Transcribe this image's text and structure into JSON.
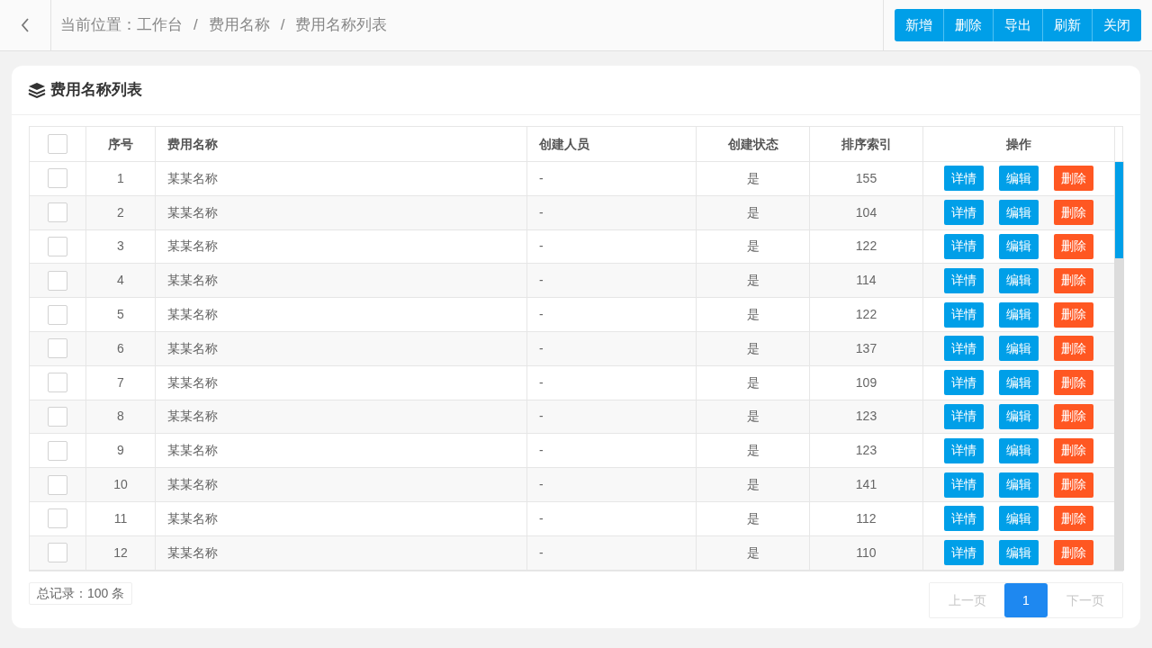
{
  "breadcrumb": {
    "label": "当前位置：",
    "items": [
      "工作台",
      "费用名称",
      "费用名称列表"
    ],
    "separator": "/"
  },
  "toolbar": [
    "新增",
    "删除",
    "导出",
    "刷新",
    "关闭"
  ],
  "panel": {
    "title": "费用名称列表"
  },
  "table": {
    "select_all_checked": false,
    "columns": [
      "序号",
      "费用名称",
      "创建人员",
      "创建状态",
      "排序索引",
      "操作"
    ],
    "rows": [
      {
        "checked": false,
        "cells": [
          "1",
          "某某名称",
          "-",
          "是",
          "155"
        ],
        "actions": [
          "详情",
          "编辑",
          "删除"
        ]
      },
      {
        "checked": false,
        "cells": [
          "2",
          "某某名称",
          "-",
          "是",
          "104"
        ],
        "actions": [
          "详情",
          "编辑",
          "删除"
        ]
      },
      {
        "checked": false,
        "cells": [
          "3",
          "某某名称",
          "-",
          "是",
          "122"
        ],
        "actions": [
          "详情",
          "编辑",
          "删除"
        ]
      },
      {
        "checked": false,
        "cells": [
          "4",
          "某某名称",
          "-",
          "是",
          "114"
        ],
        "actions": [
          "详情",
          "编辑",
          "删除"
        ]
      },
      {
        "checked": false,
        "cells": [
          "5",
          "某某名称",
          "-",
          "是",
          "122"
        ],
        "actions": [
          "详情",
          "编辑",
          "删除"
        ]
      },
      {
        "checked": false,
        "cells": [
          "6",
          "某某名称",
          "-",
          "是",
          "137"
        ],
        "actions": [
          "详情",
          "编辑",
          "删除"
        ]
      },
      {
        "checked": false,
        "cells": [
          "7",
          "某某名称",
          "-",
          "是",
          "109"
        ],
        "actions": [
          "详情",
          "编辑",
          "删除"
        ]
      },
      {
        "checked": false,
        "cells": [
          "8",
          "某某名称",
          "-",
          "是",
          "123"
        ],
        "actions": [
          "详情",
          "编辑",
          "删除"
        ]
      },
      {
        "checked": false,
        "cells": [
          "9",
          "某某名称",
          "-",
          "是",
          "123"
        ],
        "actions": [
          "详情",
          "编辑",
          "删除"
        ]
      },
      {
        "checked": false,
        "cells": [
          "10",
          "某某名称",
          "-",
          "是",
          "141"
        ],
        "actions": [
          "详情",
          "编辑",
          "删除"
        ]
      },
      {
        "checked": false,
        "cells": [
          "11",
          "某某名称",
          "-",
          "是",
          "112"
        ],
        "actions": [
          "详情",
          "编辑",
          "删除"
        ]
      },
      {
        "checked": false,
        "cells": [
          "12",
          "某某名称",
          "-",
          "是",
          "110"
        ],
        "actions": [
          "详情",
          "编辑",
          "删除"
        ]
      }
    ]
  },
  "total": "总记录：100 条",
  "pagination": [
    {
      "label": "上一页",
      "kind": "prev",
      "selected": false,
      "disabled": true
    },
    {
      "label": "1",
      "kind": "page",
      "selected": true
    },
    {
      "label": "下一页",
      "kind": "next",
      "selected": false,
      "disabled": true
    }
  ]
}
